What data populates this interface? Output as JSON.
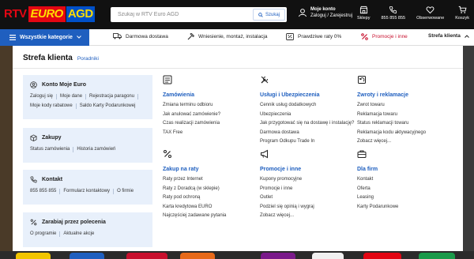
{
  "brand": {
    "rtv": "RTV",
    "euro": "EURO",
    "agd": "AGD"
  },
  "search": {
    "placeholder": "Szukaj w RTV Euro AGD",
    "button_label": "Szukaj"
  },
  "account": {
    "title": "Moje konto",
    "subtitle": "Zaloguj / Zarejestruj"
  },
  "top_icons": [
    {
      "icon": "store-icon",
      "label": "Sklepy"
    },
    {
      "icon": "phone-icon",
      "label": "855 855 855"
    },
    {
      "icon": "heart-icon",
      "label": "Obserwowane"
    },
    {
      "icon": "cart-icon",
      "label": "Koszyk"
    }
  ],
  "nav": {
    "all_categories": "Wszystkie kategorie",
    "items": [
      {
        "icon": "truck-icon",
        "label": "Darmowa dostawa"
      },
      {
        "icon": "hammer-icon",
        "label": "Wniesienie, montaż, instalacja"
      },
      {
        "icon": "percent-card-icon",
        "label": "Prawdziwe raty 0%"
      },
      {
        "icon": "percent-icon",
        "label": "Promocje i inne"
      },
      {
        "icon": "chevron-down-icon",
        "label": "Strefa klienta"
      }
    ]
  },
  "panel": {
    "title": "Strefa klienta",
    "guides_link": "Poradniki",
    "cards": [
      {
        "icon": "user-icon",
        "title": "Konto Moje Euro",
        "links": [
          "Zaloguj się",
          "Moje dane",
          "Rejestracja paragonu",
          "Moje kody rabatowe",
          "Saldo Karty Podarunkowej"
        ]
      },
      {
        "icon": "box-icon",
        "title": "Zakupy",
        "links": [
          "Status zamówienia",
          "Historia zamówień"
        ]
      },
      {
        "icon": "phone-icon",
        "title": "Kontakt",
        "links": [
          "855 855 855",
          "Formularz kontaktowy",
          "O firmie"
        ]
      },
      {
        "icon": "percent-icon",
        "title": "Zarabiaj przez polecenia",
        "links": [
          "O programie",
          "Aktualne akcje"
        ]
      }
    ],
    "columns": [
      {
        "icon": "document-icon",
        "title": "Zamówienia",
        "items": [
          "Zmiana terminu odbioru",
          "Jak anulować zamówienie?",
          "Czas realizacji zamówienia",
          "TAX Free"
        ]
      },
      {
        "icon": "tools-icon",
        "title": "Usługi i Ubezpieczenia",
        "items": [
          "Cennik usług dodatkowych",
          "Ubezpieczenia",
          "Jak przygotować się na dostawę i instalację?",
          "Darmowa dostawa",
          "Program Odkupu Trade In"
        ]
      },
      {
        "icon": "return-icon",
        "title": "Zwroty i reklamacje",
        "items": [
          "Zwrot towaru",
          "Reklamacja towaru",
          "Status reklamacji towaru",
          "Reklamacja kodu aktywacyjnego",
          "Zobacz więcej..."
        ]
      },
      {
        "icon": "percent-icon",
        "title": "Zakup na raty",
        "items": [
          "Raty przez Internet",
          "Raty z Doradcą (w sklepie)",
          "Raty pod ochroną",
          "Karta kredytowa EURO",
          "Najczęściej zadawane pytania"
        ]
      },
      {
        "icon": "megaphone-icon",
        "title": "Promocje i inne",
        "items": [
          "Kupony promocyjne",
          "Promocje i inne",
          "Outlet",
          "Podziel się opinią i wygraj",
          "Zobacz więcej..."
        ]
      },
      {
        "icon": "briefcase-icon",
        "title": "Dla firm",
        "items": [
          "Kontakt",
          "Oferta",
          "Leasing",
          "Karty Podarunkowe"
        ]
      }
    ]
  },
  "colors": {
    "accent": "#1f5fbf",
    "brand_red": "#e30613",
    "brand_yellow": "#ffdd00",
    "card_bg": "#e8f0fb",
    "header_bg": "#111111"
  }
}
